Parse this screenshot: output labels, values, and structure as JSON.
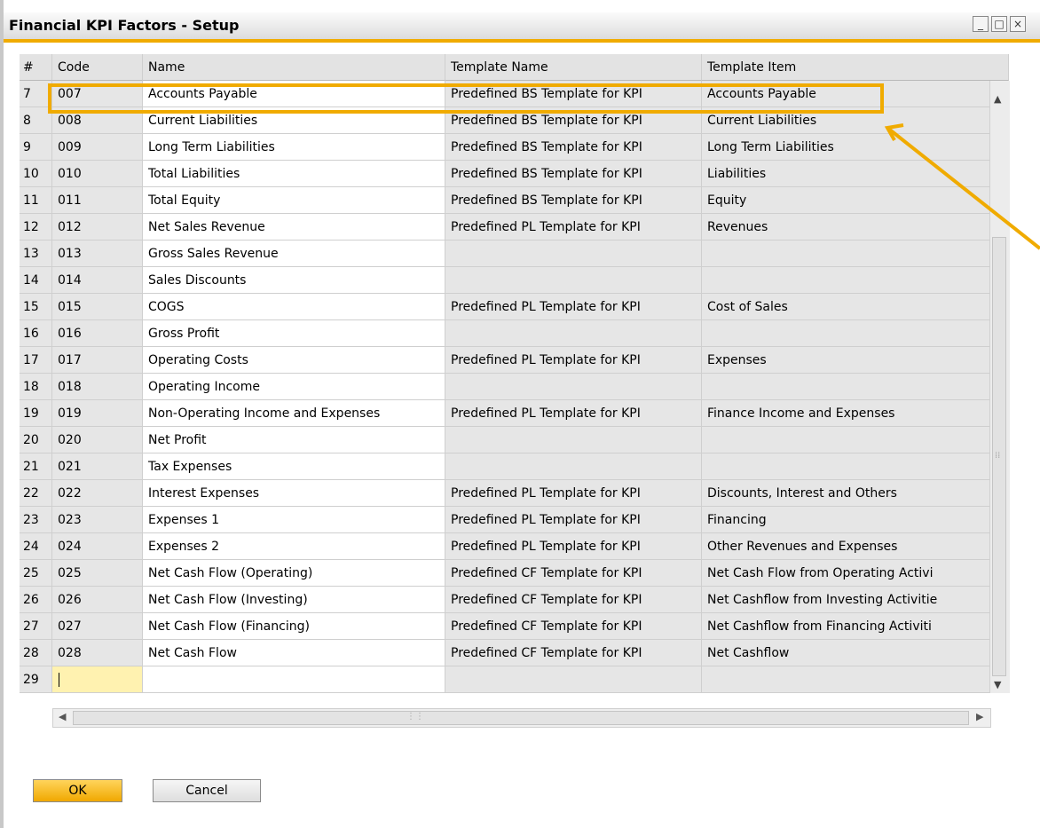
{
  "window": {
    "title": "Financial KPI Factors - Setup",
    "controls": {
      "minimize": "_",
      "maximize": "□",
      "close": "×"
    }
  },
  "grid": {
    "columns": [
      "#",
      "Code",
      "Name",
      "Template Name",
      "Template Item"
    ],
    "rows": [
      {
        "num": "7",
        "code": "007",
        "name": "Accounts Payable",
        "template_name": "Predefined BS Template for KPI",
        "template_item": "Accounts Payable"
      },
      {
        "num": "8",
        "code": "008",
        "name": "Current Liabilities",
        "template_name": "Predefined BS Template for KPI",
        "template_item": "Current Liabilities"
      },
      {
        "num": "9",
        "code": "009",
        "name": "Long Term Liabilities",
        "template_name": "Predefined BS Template for KPI",
        "template_item": "Long Term Liabilities"
      },
      {
        "num": "10",
        "code": "010",
        "name": "Total Liabilities",
        "template_name": "Predefined BS Template for KPI",
        "template_item": "Liabilities"
      },
      {
        "num": "11",
        "code": "011",
        "name": "Total Equity",
        "template_name": "Predefined BS Template for KPI",
        "template_item": "Equity"
      },
      {
        "num": "12",
        "code": "012",
        "name": "Net Sales Revenue",
        "template_name": "Predefined PL Template for KPI",
        "template_item": "Revenues"
      },
      {
        "num": "13",
        "code": "013",
        "name": "Gross Sales Revenue",
        "template_name": "",
        "template_item": ""
      },
      {
        "num": "14",
        "code": "014",
        "name": "Sales Discounts",
        "template_name": "",
        "template_item": ""
      },
      {
        "num": "15",
        "code": "015",
        "name": "COGS",
        "template_name": "Predefined PL Template for KPI",
        "template_item": "Cost of Sales"
      },
      {
        "num": "16",
        "code": "016",
        "name": "Gross Profit",
        "template_name": "",
        "template_item": ""
      },
      {
        "num": "17",
        "code": "017",
        "name": "Operating Costs",
        "template_name": "Predefined PL Template for KPI",
        "template_item": "Expenses"
      },
      {
        "num": "18",
        "code": "018",
        "name": "Operating Income",
        "template_name": "",
        "template_item": ""
      },
      {
        "num": "19",
        "code": "019",
        "name": "Non-Operating Income and Expenses",
        "template_name": "Predefined PL Template for KPI",
        "template_item": "Finance Income and Expenses"
      },
      {
        "num": "20",
        "code": "020",
        "name": "Net Profit",
        "template_name": "",
        "template_item": ""
      },
      {
        "num": "21",
        "code": "021",
        "name": "Tax Expenses",
        "template_name": "",
        "template_item": ""
      },
      {
        "num": "22",
        "code": "022",
        "name": "Interest Expenses",
        "template_name": "Predefined PL Template for KPI",
        "template_item": "Discounts, Interest and Others"
      },
      {
        "num": "23",
        "code": "023",
        "name": "Expenses 1",
        "template_name": "Predefined PL Template for KPI",
        "template_item": "Financing"
      },
      {
        "num": "24",
        "code": "024",
        "name": "Expenses 2",
        "template_name": "Predefined PL Template for KPI",
        "template_item": "Other Revenues and Expenses"
      },
      {
        "num": "25",
        "code": "025",
        "name": "Net Cash Flow (Operating)",
        "template_name": "Predefined CF Template for KPI",
        "template_item": "Net Cash Flow from Operating Activi"
      },
      {
        "num": "26",
        "code": "026",
        "name": "Net Cash Flow (Investing)",
        "template_name": "Predefined CF Template for KPI",
        "template_item": "Net Cashflow from Investing Activitie"
      },
      {
        "num": "27",
        "code": "027",
        "name": "Net Cash Flow (Financing)",
        "template_name": "Predefined CF Template for KPI",
        "template_item": "Net Cashflow from Financing Activiti"
      },
      {
        "num": "28",
        "code": "028",
        "name": "Net Cash Flow",
        "template_name": "Predefined CF Template for KPI",
        "template_item": "Net Cashflow"
      },
      {
        "num": "29",
        "code": "",
        "name": "",
        "template_name": "",
        "template_item": ""
      }
    ]
  },
  "buttons": {
    "ok": "OK",
    "cancel": "Cancel"
  },
  "colors": {
    "accent": "#f0ab00",
    "readonly_cell": "#e6e6e6",
    "active_cell": "#fff2b0"
  }
}
